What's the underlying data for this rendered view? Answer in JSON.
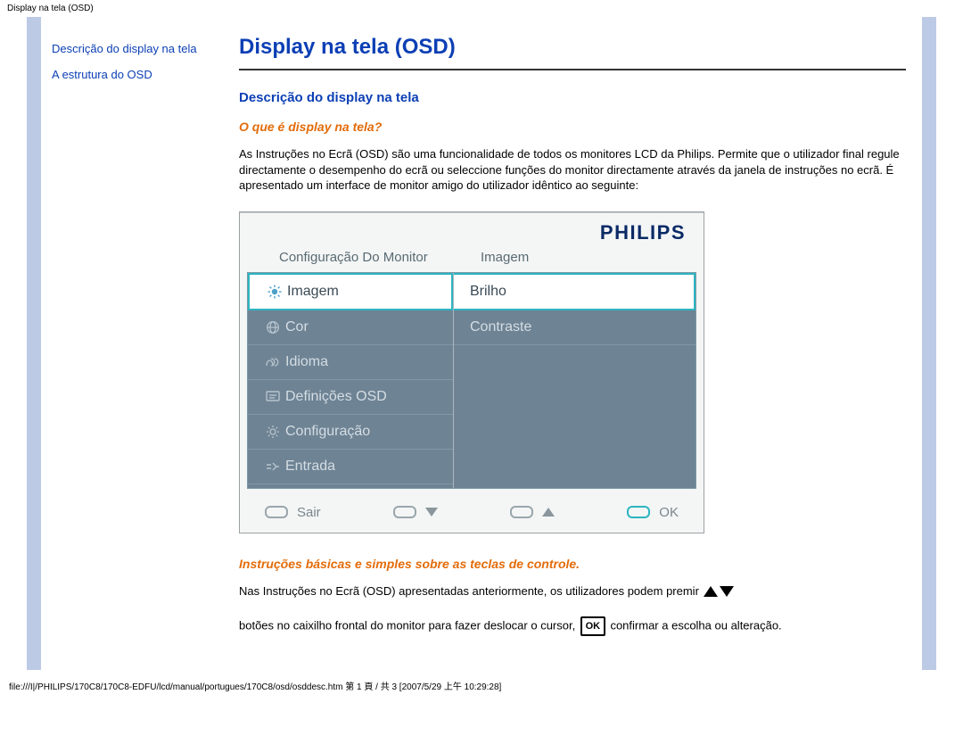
{
  "meta": {
    "top_label": "Display na tela (OSD)"
  },
  "sidebar": {
    "link1": "Descrição do display na tela",
    "link2": "A estrutura do OSD"
  },
  "main": {
    "title": "Display na tela (OSD)",
    "section_title": "Descrição do display na tela",
    "q1": "O que é display na tela?",
    "p1": "As Instruções no Ecrã (OSD) são uma funcionalidade de todos os monitores LCD da Philips. Permite que o utilizador final regule directamente o desempenho do ecrã ou seleccione funções do monitor directamente através da janela de instruções no ecrã. É apresentado um interface de monitor amigo do utilizador idêntico ao seguinte:",
    "q2": "Instruções básicas e simples sobre as teclas de controle.",
    "p2a": "Nas Instruções no Ecrã (OSD) apresentadas anteriormente, os utilizadores podem premir",
    "p2b": "botões no caixilho frontal do monitor para fazer deslocar o cursor,",
    "p2c": " confirmar a escolha ou alteração."
  },
  "osd": {
    "logo": "PHILIPS",
    "header_left": "Configuração Do Monitor",
    "header_right": "Imagem",
    "left_items": [
      {
        "icon": "brightness-icon",
        "label": "Imagem",
        "selected": true
      },
      {
        "icon": "globe-icon",
        "label": "Cor",
        "selected": false
      },
      {
        "icon": "language-icon",
        "label": "Idioma",
        "selected": false
      },
      {
        "icon": "osd-icon",
        "label": "Definições OSD",
        "selected": false
      },
      {
        "icon": "gear-icon",
        "label": "Configuração",
        "selected": false
      },
      {
        "icon": "input-icon",
        "label": "Entrada",
        "selected": false
      }
    ],
    "right_items": [
      {
        "label": "Brilho",
        "selected": true
      },
      {
        "label": "Contraste",
        "selected": false
      }
    ],
    "footer": {
      "exit": "Sair",
      "ok": "OK"
    }
  },
  "footer": {
    "path": "file:///I|/PHILIPS/170C8/170C8-EDFU/lcd/manual/portugues/170C8/osd/osddesc.htm 第 1 頁 / 共 3  [2007/5/29 上午 10:29:28]"
  }
}
